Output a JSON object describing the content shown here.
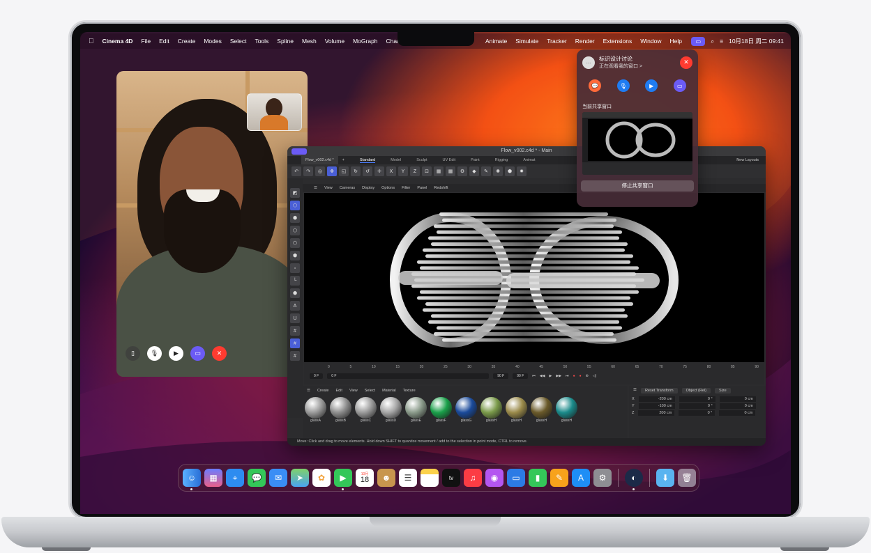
{
  "menubar": {
    "app_name": "Cinema 4D",
    "menus": [
      "File",
      "Edit",
      "Create",
      "Modes",
      "Select",
      "Tools",
      "Spline",
      "Mesh",
      "Volume",
      "MoGraph",
      "Character"
    ],
    "menus_right": [
      "Animate",
      "Simulate",
      "Tracker",
      "Render",
      "Extensions",
      "Window",
      "Help"
    ],
    "datetime": "10月18日 周二  09:41"
  },
  "c4d": {
    "window_title": "Flow_v002.c4d * - Main",
    "file_tab": "Flow_v002.c4d *",
    "layout_tabs": [
      "Standard",
      "Model",
      "Sculpt",
      "UV Edit",
      "Paint",
      "Rigging",
      "Animat"
    ],
    "new_layouts": "New Layouts",
    "viewport_menu": [
      "View",
      "Cameras",
      "Display",
      "Options",
      "Filter",
      "Panel",
      "Redshift"
    ],
    "timeline_ticks": [
      "0",
      "5",
      "10",
      "15",
      "20",
      "25",
      "30",
      "35",
      "40",
      "45",
      "50",
      "55",
      "60",
      "65",
      "70",
      "75",
      "80",
      "85",
      "90"
    ],
    "frame_start": "0 F",
    "frame_current": "0 F",
    "frame_end": "90 F",
    "frame_end2": "90 F",
    "material_menu": [
      "Create",
      "Edit",
      "View",
      "Select",
      "Material",
      "Texture"
    ],
    "materials": [
      {
        "name": "glassA",
        "color": "#9a9a9a"
      },
      {
        "name": "glassB",
        "color": "#8d8d8d"
      },
      {
        "name": "glassC",
        "color": "#9a9a9a"
      },
      {
        "name": "glassD",
        "color": "#a5a5a5"
      },
      {
        "name": "glassE",
        "color": "#8a9a8a"
      },
      {
        "name": "glassF",
        "color": "#1aa04a"
      },
      {
        "name": "glassG",
        "color": "#1a4a9a"
      },
      {
        "name": "glassH",
        "color": "#7a9a4a"
      },
      {
        "name": "glassH",
        "color": "#9a8a4a"
      },
      {
        "name": "glassH",
        "color": "#6a5a2a"
      },
      {
        "name": "glassH",
        "color": "#1a8a8a"
      }
    ],
    "attr_reset": "Reset Transform",
    "attr_mode": "Object (Rel)",
    "attr_size": "Size",
    "attr_rows": [
      {
        "axis": "X",
        "pos": "-200 cm",
        "rot": "0 °",
        "size": "0 cm"
      },
      {
        "axis": "Y",
        "pos": "-100 cm",
        "rot": "0 °",
        "size": "0 cm"
      },
      {
        "axis": "Z",
        "pos": "200 cm",
        "rot": "0 °",
        "size": "0 cm"
      }
    ],
    "status_text": "Move: Click and drag to move elements. Hold down SHIFT to quantize movement / add to the selection in point mode, CTRL to remove."
  },
  "popover": {
    "title": "标识设计讨论",
    "subtitle": "正在观看我的窗口 >",
    "section_label": "当前共享窗口",
    "stop_label": "停止共享窗口"
  },
  "dock": {
    "calendar_month": "10月",
    "calendar_day": "18",
    "tv_label": "tv"
  }
}
